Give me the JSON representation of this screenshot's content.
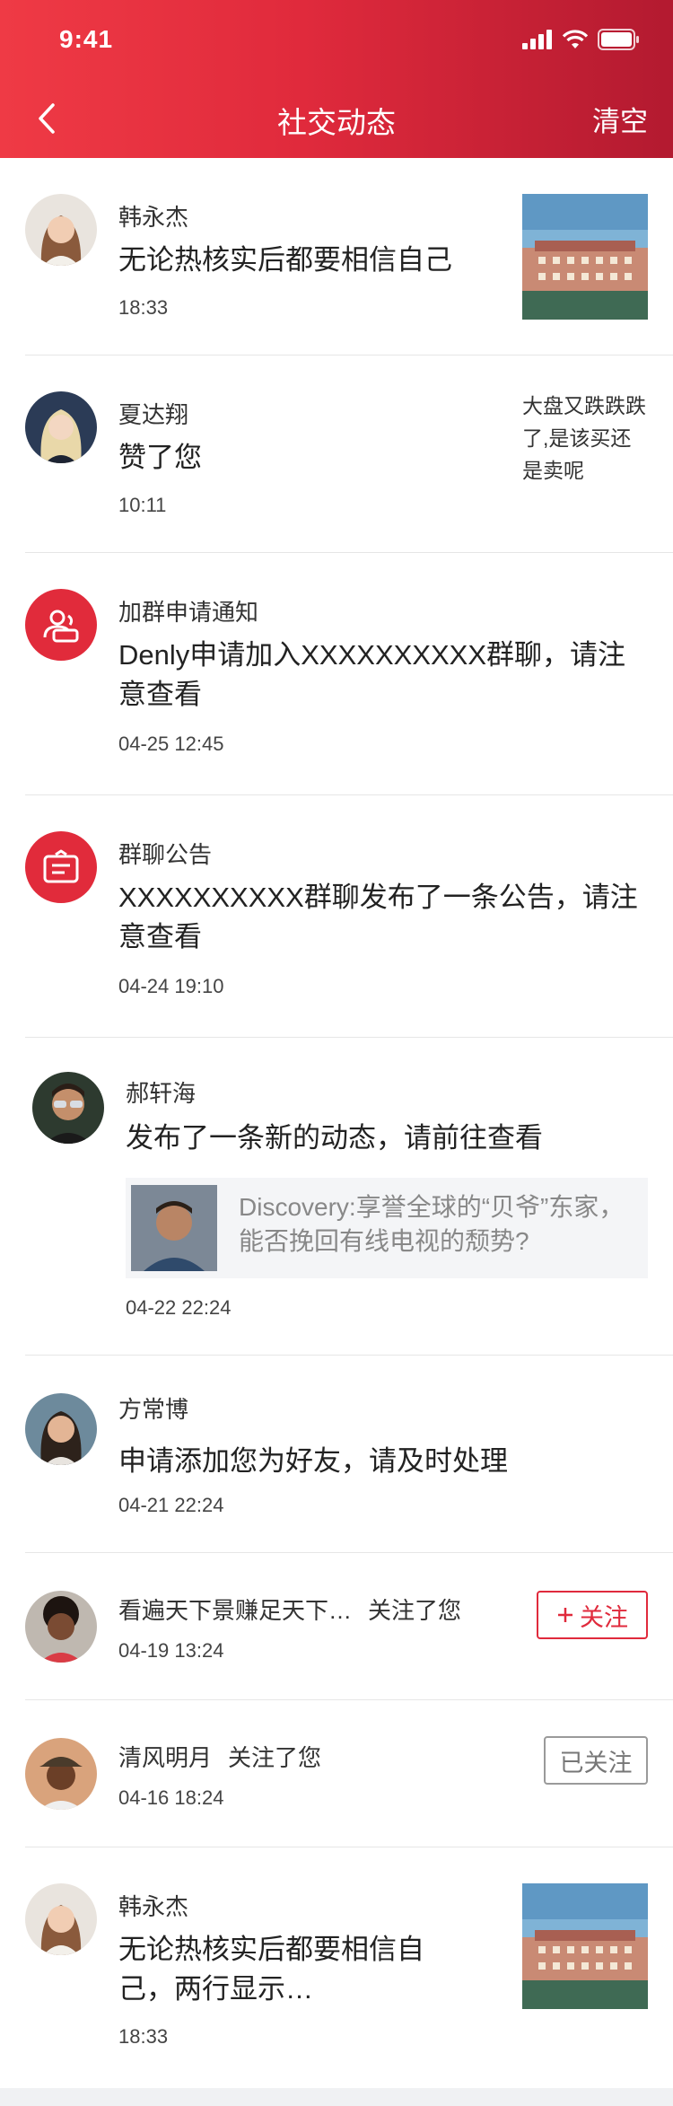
{
  "status": {
    "time": "9:41"
  },
  "nav": {
    "title": "社交动态",
    "clear_label": "清空"
  },
  "items": [
    {
      "name": "韩永杰",
      "message": "无论热核实后都要相信自己",
      "time": "18:33",
      "avatar": "woman-avatar",
      "thumb": "hotel-photo"
    },
    {
      "name": "夏达翔",
      "message": "赞了您",
      "time": "10:11",
      "avatar": "woman-avatar",
      "side_text": "大盘又跌跌跌了,是该买还是卖呢"
    },
    {
      "name": "加群申请通知",
      "message": "Denly申请加入XXXXXXXXXX群聊，请注意查看",
      "time": "04-25 12:45",
      "icon": "group-request-icon"
    },
    {
      "name": "群聊公告",
      "message": "XXXXXXXXXX群聊发布了一条公告，请注意查看",
      "time": "04-24 19:10",
      "icon": "announcement-icon"
    },
    {
      "name": "郝轩海",
      "message": "发布了一条新的动态，请前往查看",
      "time": "04-22 22:24",
      "avatar": "man-avatar",
      "quote": "Discovery:享誉全球的“贝爷”东家，能否挽回有线电视的颓势?"
    },
    {
      "name": "方常博",
      "message": "申请添加您为好友，请及时处理",
      "time": "04-21 22:24",
      "avatar": "woman-avatar"
    },
    {
      "name": "看遍天下景赚足天下…",
      "action": "关注了您",
      "time": "04-19 13:24",
      "avatar": "woman-avatar",
      "button": "关注"
    },
    {
      "name": "清风明月",
      "action": "关注了您",
      "time": "04-16 18:24",
      "avatar": "man-avatar",
      "button": "已关注"
    },
    {
      "name": "韩永杰",
      "message": "无论热核实后都要相信自己，两行显示…",
      "time": "18:33",
      "avatar": "woman-avatar",
      "thumb": "hotel-photo"
    }
  ],
  "colors": {
    "brand": "#e02a3c",
    "header_dark": "#b31a30"
  }
}
